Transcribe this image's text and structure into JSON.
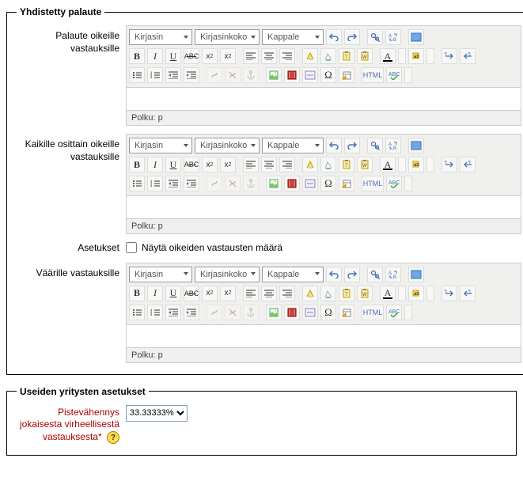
{
  "fieldset1": {
    "legend": "Yhdistetty palaute",
    "labels": {
      "correct": "Palaute oikeille vastauksille",
      "partial": "Kaikille osittain oikeille vastauksille",
      "settings": "Asetukset",
      "wrong": "Väärille vastauksille"
    },
    "settingsChkLabel": "Näytä oikeiden vastausten määrä"
  },
  "fieldset2": {
    "legend": "Useiden yritysten asetukset",
    "penaltyLabel": "Pistevähennys jokaisesta virheellisestä vastauksesta",
    "penaltyValue": "33.33333%"
  },
  "editor": {
    "font": "Kirjasin",
    "size": "Kirjasinkoko",
    "format": "Kappale",
    "pathLabel": "Polku:",
    "pathValue": "p"
  },
  "icons": {
    "help": "?",
    "star": "*"
  }
}
